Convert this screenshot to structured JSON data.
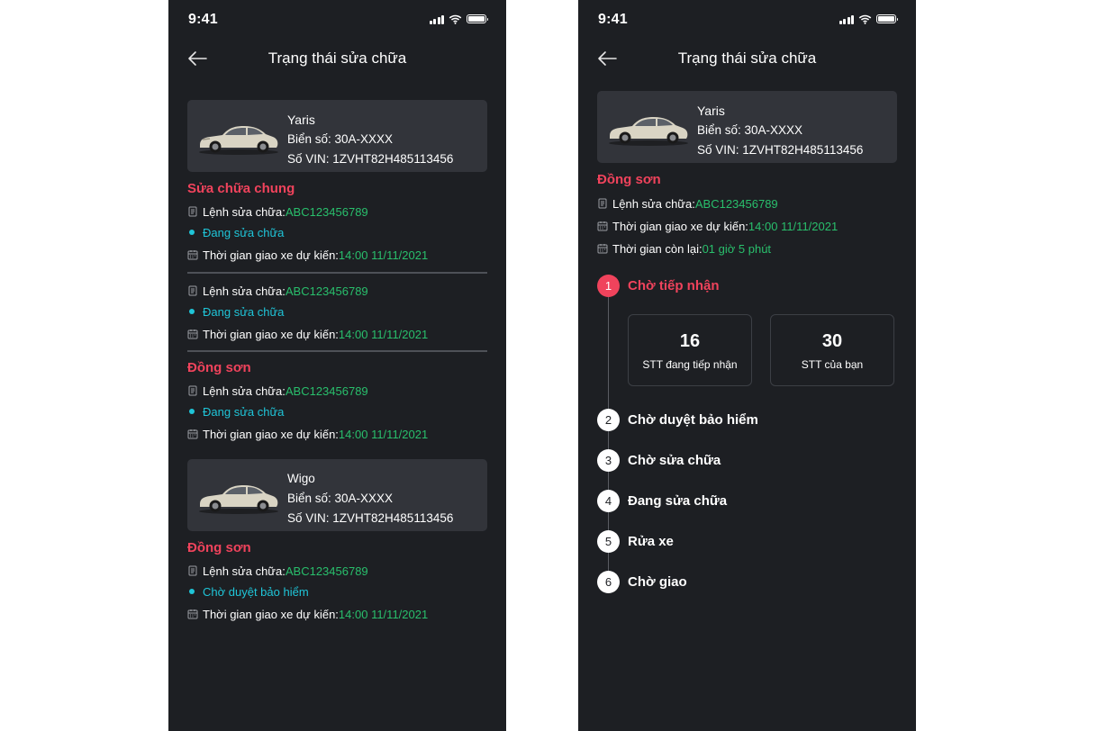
{
  "status_bar": {
    "time": "9:41"
  },
  "screen_left": {
    "title": "Trạng thái sửa chữa",
    "cars": [
      {
        "name": "Yaris",
        "plate": "Biển số: 30A-XXXX",
        "vin": "Số VIN: 1ZVHT82H485113456",
        "orders": [
          {
            "section": "Sửa chữa chung",
            "order_label": "Lệnh sửa chữa: ",
            "order_code": "ABC123456789",
            "status": "Đang sửa chữa",
            "delivery_label": "Thời gian giao xe dự kiến: ",
            "delivery_time": "14:00 11/11/2021"
          },
          {
            "section": "",
            "order_label": "Lệnh sửa chữa: ",
            "order_code": "ABC123456789",
            "status": "Đang sửa chữa",
            "delivery_label": "Thời gian giao xe dự kiến: ",
            "delivery_time": "14:00 11/11/2021"
          },
          {
            "section": "Đồng sơn",
            "order_label": "Lệnh sửa chữa: ",
            "order_code": "ABC123456789",
            "status": "Đang sửa chữa",
            "delivery_label": "Thời gian giao xe dự kiến: ",
            "delivery_time": "14:00 11/11/2021"
          }
        ]
      },
      {
        "name": "Wigo",
        "plate": "Biển số: 30A-XXXX",
        "vin": "Số VIN: 1ZVHT82H485113456",
        "orders": [
          {
            "section": "Đồng sơn",
            "order_label": "Lệnh sửa chữa: ",
            "order_code": "ABC123456789",
            "status": "Chờ duyệt bảo hiểm",
            "delivery_label": "Thời gian giao xe dự kiến: ",
            "delivery_time": "14:00 11/11/2021"
          }
        ]
      }
    ]
  },
  "screen_right": {
    "title": "Trạng thái sửa chữa",
    "car": {
      "name": "Yaris",
      "plate": "Biển số: 30A-XXXX",
      "vin": "Số VIN: 1ZVHT82H485113456"
    },
    "section": "Đồng sơn",
    "order_label": "Lệnh sửa chữa: ",
    "order_code": "ABC123456789",
    "delivery_label": "Thời gian giao xe dự kiến: ",
    "delivery_time": "14:00 11/11/2021",
    "remaining_label": "Thời gian còn lại: ",
    "remaining_time": "01 giờ 5 phút",
    "queue": {
      "current_value": "16",
      "current_label": "STT đang tiếp nhận",
      "mine_value": "30",
      "mine_label": "STT của bạn"
    },
    "steps": [
      {
        "num": "1",
        "label": "Chờ tiếp nhận"
      },
      {
        "num": "2",
        "label": "Chờ duyệt bảo hiểm"
      },
      {
        "num": "3",
        "label": "Chờ sửa chữa"
      },
      {
        "num": "4",
        "label": "Đang sửa chữa"
      },
      {
        "num": "5",
        "label": "Rửa xe"
      },
      {
        "num": "6",
        "label": "Chờ giao"
      }
    ],
    "active_step": 1
  },
  "colors": {
    "background": "#1d1f23",
    "card": "#32343a",
    "accent_red": "#f0435c",
    "green": "#29bf6c",
    "cyan": "#1fc5d8"
  },
  "icons": [
    "back-arrow-icon",
    "signal-icon",
    "wifi-icon",
    "battery-icon",
    "document-icon",
    "calendar-icon",
    "status-dot-icon",
    "car-image"
  ]
}
